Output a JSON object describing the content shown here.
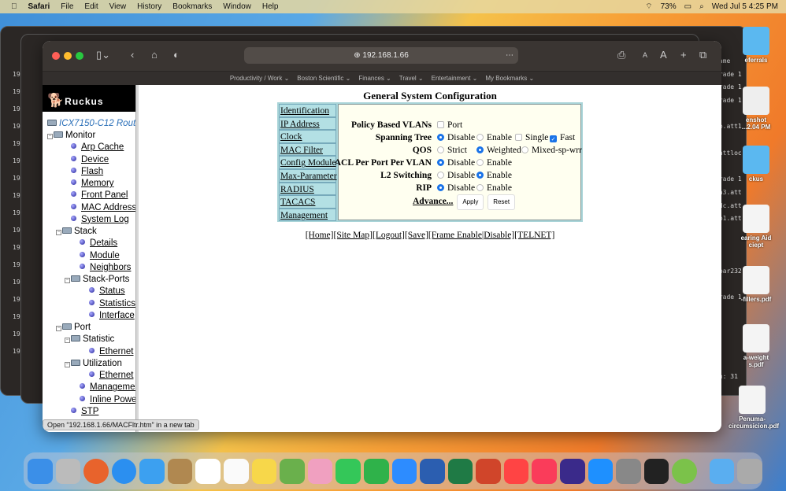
{
  "menubar": {
    "app": "Safari",
    "items": [
      "File",
      "Edit",
      "View",
      "History",
      "Bookmarks",
      "Window",
      "Help"
    ],
    "battery": "73%",
    "clock": "Wed Jul 5  4:25 PM"
  },
  "browser": {
    "url": "192.168.1.66",
    "bookmarks": [
      "Productivity / Work ⌄",
      "Boston Scientific ⌄",
      "Finances ⌄",
      "Travel ⌄",
      "Entertainment ⌄",
      "My Bookmarks ⌄"
    ],
    "status": "Open “192.168.1.66/MACFltr.htm” in a new tab"
  },
  "sidebar": {
    "logo": "Ruckus",
    "root": "ICX7150-C12 Router",
    "items": [
      {
        "label": "Monitor",
        "type": "folder",
        "level": 0
      },
      {
        "label": "Arp Cache",
        "type": "leaf",
        "level": 1
      },
      {
        "label": "Device",
        "type": "leaf",
        "level": 1
      },
      {
        "label": "Flash",
        "type": "leaf",
        "level": 1
      },
      {
        "label": "Memory",
        "type": "leaf",
        "level": 1
      },
      {
        "label": "Front Panel",
        "type": "leaf",
        "level": 1
      },
      {
        "label": "MAC Address",
        "type": "leaf",
        "level": 1
      },
      {
        "label": "System Log",
        "type": "leaf",
        "level": 1
      },
      {
        "label": "Stack",
        "type": "folder",
        "level": 1
      },
      {
        "label": "Details",
        "type": "leaf",
        "level": 2
      },
      {
        "label": "Module",
        "type": "leaf",
        "level": 2
      },
      {
        "label": "Neighbors",
        "type": "leaf",
        "level": 2
      },
      {
        "label": "Stack-Ports",
        "type": "folder",
        "level": 2
      },
      {
        "label": "Status",
        "type": "leaf",
        "level": 3
      },
      {
        "label": "Statistics",
        "type": "leaf",
        "level": 3
      },
      {
        "label": "Interface",
        "type": "leaf",
        "level": 3
      },
      {
        "label": "Port",
        "type": "folder",
        "level": 1
      },
      {
        "label": "Statistic",
        "type": "folder",
        "level": 2
      },
      {
        "label": "Ethernet",
        "type": "leaf",
        "level": 3
      },
      {
        "label": "Utilization",
        "type": "folder",
        "level": 2
      },
      {
        "label": "Ethernet",
        "type": "leaf",
        "level": 3
      },
      {
        "label": "Management",
        "type": "leaf",
        "level": 2
      },
      {
        "label": "Inline Power",
        "type": "leaf",
        "level": 2
      },
      {
        "label": "STP",
        "type": "leaf",
        "level": 1
      }
    ]
  },
  "page": {
    "title": "General System Configuration",
    "nav": [
      "Identification",
      "IP Address",
      "Clock",
      "MAC Filter",
      "Config Module",
      "Max-Parameter",
      "RADIUS",
      "TACACS",
      "Management"
    ],
    "policy_vlans": {
      "label": "Policy Based VLANs",
      "port": "Port",
      "checked": false
    },
    "spanning_tree": {
      "label": "Spanning Tree",
      "disable": "Disable",
      "enable": "Enable",
      "single": "Single",
      "fast": "Fast",
      "selected": "Disable",
      "single_checked": false,
      "fast_checked": true
    },
    "qos": {
      "label": "QOS",
      "strict": "Strict",
      "weighted": "Weighted",
      "mixed": "Mixed-sp-wrr",
      "selected": "Weighted"
    },
    "acl": {
      "label": "ACL Per Port Per VLAN",
      "disable": "Disable",
      "enable": "Enable",
      "selected": "Disable"
    },
    "l2": {
      "label": "L2 Switching",
      "disable": "Disable",
      "enable": "Enable",
      "selected": "Enable"
    },
    "rip": {
      "label": "RIP",
      "disable": "Disable",
      "enable": "Enable",
      "selected": "Disable"
    },
    "advance": "Advance...",
    "apply": "Apply",
    "reset": "Reset",
    "footer": [
      "[Home]",
      "[Site Map]",
      "[Logout]",
      "[Save]",
      "[Frame Enable",
      "|Disable]",
      "[TELNET]"
    ]
  },
  "desktop": {
    "icons": [
      "eferrals",
      "enshot ...2.04 PM",
      "ckus",
      "earing Aid ciept",
      "-fillers.pdf",
      "a-weight s.pdf",
      "Penuma-circumsicion.pdf"
    ],
    "finder_rows": [
      "Name",
      "grade 1",
      "grade 1",
      "grade 1",
      "",
      "bp.att1",
      "",
      ".attloc",
      "",
      "grade 1",
      "2a3.att",
      "2dc.att",
      "eb1.att",
      "",
      "",
      "",
      "mbar232",
      "",
      "grade 1",
      "",
      "",
      "",
      "",
      "",
      "en: 31"
    ]
  }
}
